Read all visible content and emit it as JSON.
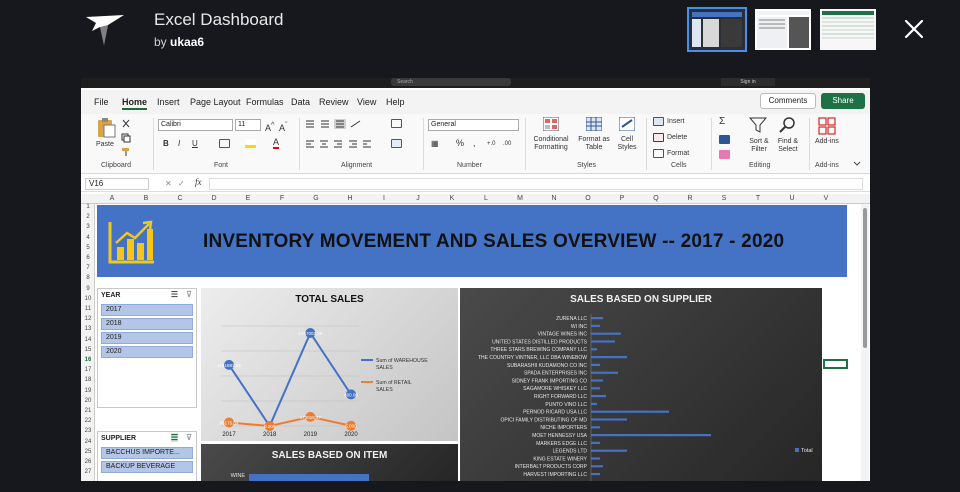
{
  "viewer": {
    "title": "Excel Dashboard",
    "by_prefix": "by",
    "author": "ukaa6"
  },
  "excel": {
    "titlebar": {
      "search": "Search",
      "sign_in": "Sign in"
    },
    "menu": [
      "File",
      "Home",
      "Insert",
      "Page Layout",
      "Formulas",
      "Data",
      "Review",
      "View",
      "Help"
    ],
    "active_menu": "Home",
    "comments": "Comments",
    "share": "Share",
    "ribbon": {
      "paste": "Paste",
      "clipboard": "Clipboard",
      "font_name": "Calibri",
      "font_size": "11",
      "font": "Font",
      "alignment": "Alignment",
      "number_format": "General",
      "number": "Number",
      "conditional_formatting": "Conditional Formatting",
      "format_as_table": "Format as Table",
      "cell_styles": "Cell Styles",
      "styles": "Styles",
      "insert": "Insert",
      "delete": "Delete",
      "format": "Format",
      "cells": "Cells",
      "sort_filter": "Sort & Filter",
      "find_select": "Find & Select",
      "editing": "Editing",
      "add_ins": "Add-ins",
      "add_ins_group": "Add-ins"
    },
    "name_box": "V16",
    "fx": "fx",
    "columns": [
      "A",
      "B",
      "C",
      "D",
      "E",
      "F",
      "G",
      "H",
      "I",
      "J",
      "K",
      "L",
      "M",
      "N",
      "O",
      "P",
      "Q",
      "R",
      "S",
      "T",
      "U",
      "V"
    ],
    "rows": [
      "1",
      "2",
      "3",
      "4",
      "5",
      "6",
      "7",
      "8",
      "9",
      "10",
      "11",
      "12",
      "13",
      "14",
      "15",
      "16",
      "17",
      "18",
      "19",
      "20",
      "21",
      "22",
      "23",
      "24",
      "25",
      "26",
      "27"
    ],
    "selected_row": "16"
  },
  "dashboard": {
    "banner_title": "INVENTORY MOVEMENT AND SALES OVERVIEW -- 2017 - 2020",
    "year_slicer": {
      "header": "YEAR",
      "items": [
        "2017",
        "2018",
        "2019",
        "2020"
      ]
    },
    "supplier_slicer": {
      "header": "SUPPLIER",
      "items": [
        "BACCHUS IMPORTE...",
        "BACKUP BEVERAGE"
      ]
    },
    "colors": {
      "banner": "#4472c4",
      "warehouse_series": "#4472c4",
      "retail_series": "#ed7d31",
      "icon": "#f5c518"
    }
  },
  "chart_data": [
    {
      "type": "line",
      "title": "TOTAL SALES",
      "categories": [
        "2017",
        "2018",
        "2019",
        "2020"
      ],
      "series": [
        {
          "name": "Sum of WAREHOUSE SALES",
          "values": [
            1161,
            0,
            1767,
            600
          ],
          "labels": [
            "1161881.63",
            "0.000",
            "1767002.39",
            "600.00"
          ]
        },
        {
          "name": "Sum of RETAIL SALES",
          "values": [
            66,
            0,
            173,
            5
          ],
          "labels": [
            "66175.84",
            "0.000",
            "173015.47",
            "5.000"
          ]
        }
      ],
      "ylim": [
        0,
        1900
      ],
      "legend": "right"
    },
    {
      "type": "bar",
      "title": "SALES BASED ON SUPPLIER",
      "categories": [
        "ZURENA LLC",
        "WI INC",
        "VINTAGE WINES INC",
        "UNITED STATES DISTILLED PRODUCTS",
        "THREE STARS BREWING COMPANY LLC",
        "THE COUNTRY VINTNER, LLC DBA WINEBOW",
        "SUBARASHII KUDAMONO CO INC",
        "SPADA ENTERPRISES INC",
        "SIDNEY FRANK IMPORTING CO",
        "SAGAMORE WHISKEY LLC",
        "RIGHT FORWARD LLC",
        "PUNTO VINO LLC",
        "PERNOD RICARD USA LLC",
        "OPICI FAMILY DISTRIBUTING OF MD",
        "NICHE IMPORTERS",
        "MOET HENNESSY USA",
        "MARKERS EDGE LLC",
        "LEGENDS LTD",
        "KING ESTATE WINERY",
        "INTERBALT PRODUCTS CORP",
        "HARVEST IMPORTING LLC"
      ],
      "series": [
        {
          "name": "Total",
          "values": [
            4,
            3,
            10,
            8,
            2,
            12,
            3,
            9,
            4,
            3,
            5,
            2,
            26,
            12,
            3,
            40,
            3,
            12,
            3,
            4,
            3
          ]
        }
      ],
      "legend": "right"
    },
    {
      "type": "bar",
      "title": "SALES BASED ON ITEM",
      "categories": [
        "WINE"
      ],
      "series": [
        {
          "name": "Total",
          "values": [
            100
          ]
        }
      ]
    }
  ]
}
